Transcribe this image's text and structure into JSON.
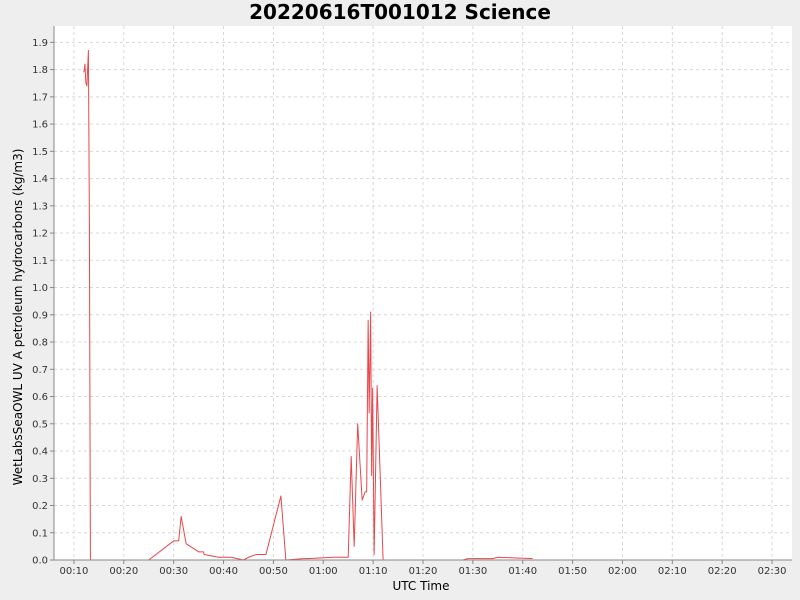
{
  "chart_data": {
    "type": "line",
    "title": "20220616T001012 Science",
    "xlabel": "UTC Time",
    "ylabel": "WetLabsSeaOWL UV A petroleum hydrocarbons (kg/m3)",
    "xlim": [
      "00:06",
      "02:34"
    ],
    "ylim": [
      0,
      1.96
    ],
    "grid": true,
    "x_ticks": [
      "00:10",
      "00:20",
      "00:30",
      "00:40",
      "00:50",
      "01:00",
      "01:10",
      "01:20",
      "01:30",
      "01:40",
      "01:50",
      "02:00",
      "02:10",
      "02:20",
      "02:30"
    ],
    "y_ticks": [
      "0.0",
      "0.1",
      "0.2",
      "0.3",
      "0.4",
      "0.5",
      "0.6",
      "0.7",
      "0.8",
      "0.9",
      "1.0",
      "1.1",
      "1.2",
      "1.3",
      "1.4",
      "1.5",
      "1.6",
      "1.7",
      "1.8",
      "1.9"
    ],
    "colors": {
      "series": "#e8474c",
      "plot_bg": "#ffffff",
      "page_bg": "#eeeeee"
    },
    "series": [
      {
        "x": [
          "00:12:00",
          "00:12:12",
          "00:12:24",
          "00:12:36",
          "00:12:54",
          "00:13:06",
          "00:13:18",
          "00:13:30",
          "00:13:42",
          "00:15:00",
          "00:20:00",
          "00:25:00",
          "00:30:00",
          "00:31:00",
          "00:31:30",
          "00:32:30",
          "00:35:00",
          "00:36:00",
          "00:36:06",
          "00:39:00",
          "00:41:30",
          "00:44:00",
          "00:45:00",
          "00:46:30",
          "00:48:30",
          "00:51:30",
          "00:52:30",
          "00:56:00",
          "00:57:00",
          "01:02:00",
          "01:05:00",
          "01:05:36",
          "01:06:12",
          "01:06:54",
          "01:07:48",
          "01:08:24",
          "01:08:42",
          "01:09:00",
          "01:09:12",
          "01:09:30",
          "01:09:42",
          "01:09:54",
          "01:10:12",
          "01:10:48",
          "01:12:00",
          "01:12:30",
          "01:28:00",
          "01:29:00",
          "01:34:00",
          "01:35:00",
          "01:42:00"
        ],
        "values": [
          1.79,
          1.82,
          1.75,
          1.74,
          1.87,
          1.22,
          0.0,
          0.0,
          0.0,
          0.0,
          0.0,
          0.0,
          0.07,
          0.07,
          0.16,
          0.06,
          0.03,
          0.03,
          0.02,
          0.01,
          0.01,
          0.0,
          0.01,
          0.02,
          0.02,
          0.235,
          0.0,
          0.005,
          0.005,
          0.01,
          0.01,
          0.38,
          0.05,
          0.5,
          0.22,
          0.25,
          0.25,
          0.88,
          0.54,
          0.91,
          0.31,
          0.63,
          0.02,
          0.64,
          0.0,
          0.0,
          0.0,
          0.005,
          0.005,
          0.01,
          0.005
        ]
      }
    ]
  }
}
